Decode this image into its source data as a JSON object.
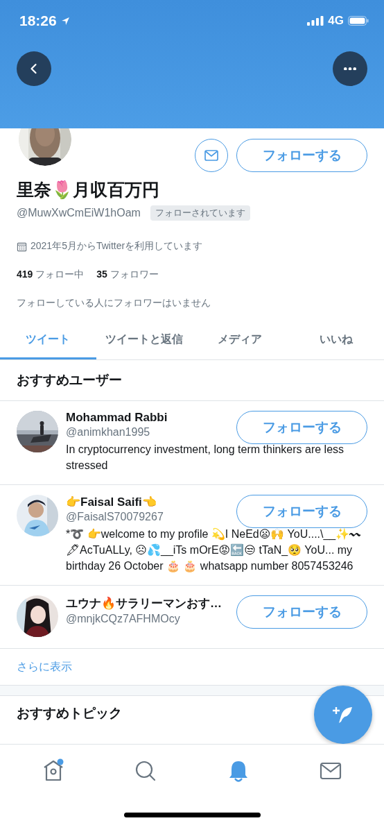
{
  "status_bar": {
    "time": "18:26",
    "network": "4G"
  },
  "profile": {
    "name": "里奈🌷月収百万円",
    "handle": "@MuwXwCmEiW1hOam",
    "follows_you": "フォローされています",
    "joined": "2021年5月からTwitterを利用しています",
    "following_count": "419",
    "following_label": "フォロー中",
    "followers_count": "35",
    "followers_label": "フォロワー",
    "mutual_note": "フォローしている人にフォロワーはいません",
    "follow_button": "フォローする"
  },
  "tabs": [
    {
      "label": "ツイート",
      "selected": true
    },
    {
      "label": "ツイートと返信",
      "selected": false
    },
    {
      "label": "メディア",
      "selected": false
    },
    {
      "label": "いいね",
      "selected": false
    }
  ],
  "suggested": {
    "title": "おすすめユーザー",
    "users": [
      {
        "name": "Mohammad Rabbi",
        "handle": "@animkhan1995",
        "bio": "In cryptocurrency investment, long term thinkers are less stressed",
        "button": "フォローする"
      },
      {
        "name": "👉Faisal Saifi👈",
        "handle": "@FaisalS70079267",
        "bio": "*➰ 👉welcome to my profile 💫I NeEd😦🙌 YoU....\\__✨〰🖋AcTuALLy, ☹💦__iTs mOrE😡🔙😒 tTaN_🥺 YoU... my birthday 26 October 🎂 🎂 whatsapp number 8057453246",
        "button": "フォローする"
      },
      {
        "name": "ユウナ🔥サラリーマンおす…",
        "handle": "@mnjkCQz7AFHMOcy",
        "button": "フォローする"
      }
    ],
    "show_more": "さらに表示"
  },
  "topics": {
    "title": "おすすめトピック"
  },
  "nav": [
    {
      "kind": "home",
      "selected": false,
      "new": true
    },
    {
      "kind": "search",
      "selected": false,
      "new": false
    },
    {
      "kind": "notifications",
      "selected": true,
      "new": false
    },
    {
      "kind": "messages",
      "selected": false,
      "new": false
    }
  ]
}
